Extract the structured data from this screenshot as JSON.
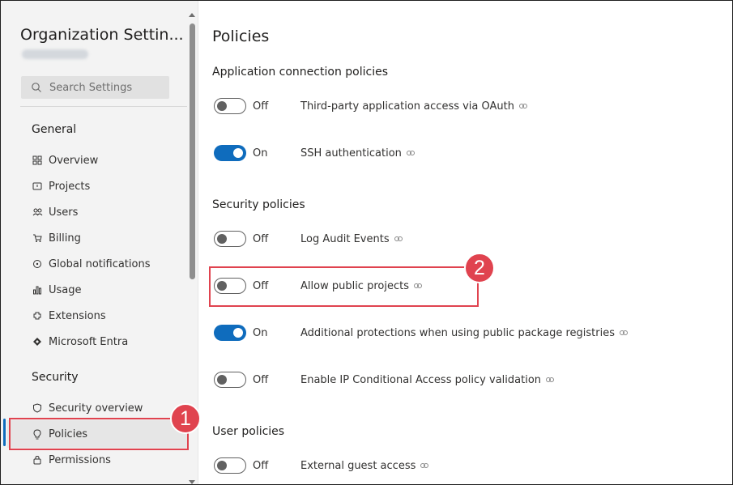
{
  "sidebar": {
    "org_title": "Organization Settin...",
    "search_placeholder": "Search Settings",
    "general": {
      "title": "General",
      "items": [
        {
          "label": "Overview",
          "icon": "overview-icon"
        },
        {
          "label": "Projects",
          "icon": "projects-icon"
        },
        {
          "label": "Users",
          "icon": "users-icon"
        },
        {
          "label": "Billing",
          "icon": "billing-cart-icon"
        },
        {
          "label": "Global notifications",
          "icon": "notifications-icon"
        },
        {
          "label": "Usage",
          "icon": "usage-chart-icon"
        },
        {
          "label": "Extensions",
          "icon": "extensions-icon"
        },
        {
          "label": "Microsoft Entra",
          "icon": "entra-diamond-icon"
        }
      ]
    },
    "security": {
      "title": "Security",
      "items": [
        {
          "label": "Security overview",
          "icon": "shield-icon"
        },
        {
          "label": "Policies",
          "icon": "policy-bulb-icon",
          "selected": true
        },
        {
          "label": "Permissions",
          "icon": "lock-icon"
        }
      ]
    }
  },
  "main": {
    "title": "Policies",
    "sections": [
      {
        "title": "Application connection policies",
        "policies": [
          {
            "state": "Off",
            "enabled": false,
            "label": "Third-party application access via OAuth"
          },
          {
            "state": "On",
            "enabled": true,
            "label": "SSH authentication"
          }
        ]
      },
      {
        "title": "Security policies",
        "policies": [
          {
            "state": "Off",
            "enabled": false,
            "label": "Log Audit Events"
          },
          {
            "state": "Off",
            "enabled": false,
            "label": "Allow public projects"
          },
          {
            "state": "On",
            "enabled": true,
            "label": "Additional protections when using public package registries"
          },
          {
            "state": "Off",
            "enabled": false,
            "label": "Enable IP Conditional Access policy validation"
          }
        ]
      },
      {
        "title": "User policies",
        "policies": [
          {
            "state": "Off",
            "enabled": false,
            "label": "External guest access"
          }
        ]
      }
    ]
  },
  "annotations": {
    "badge_1": "1",
    "badge_2": "2",
    "color": "#e0434f"
  },
  "colors": {
    "accent": "#0f6cbd",
    "sidebar_bg": "#f3f3f3"
  }
}
